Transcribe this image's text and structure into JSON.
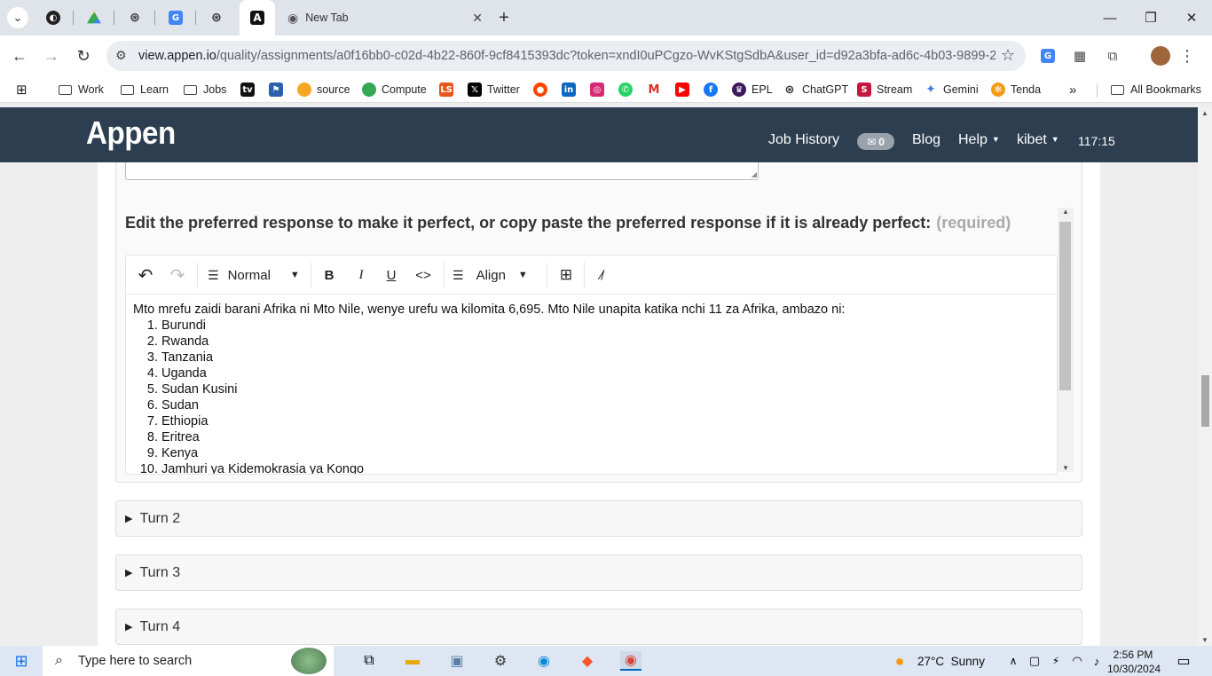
{
  "browser": {
    "tab_title": "New Tab",
    "url_host": "view.appen.io",
    "url_path": "/quality/assignments/a0f16bb0-c02d-4b22-860f-9cf8415393dc?token=xndI0uPCgzo-WvKStgSdbA&user_id=d92a3bfa-ad6c-4b03-9899-2d...",
    "bookmarks": [
      {
        "label": "Work",
        "icon": "folder-icon"
      },
      {
        "label": "Learn",
        "icon": "folder-icon"
      },
      {
        "label": "Jobs",
        "icon": "folder-icon"
      },
      {
        "label": "source",
        "icon": "source-icon"
      },
      {
        "label": "Compute",
        "icon": "compute-icon"
      },
      {
        "label": "Twitter",
        "icon": "x-icon"
      },
      {
        "label": "EPL",
        "icon": "epl-icon"
      },
      {
        "label": "ChatGPT",
        "icon": "chatgpt-icon"
      },
      {
        "label": "Stream",
        "icon": "stream-icon"
      },
      {
        "label": "Gemini",
        "icon": "gemini-icon"
      },
      {
        "label": "Tenda",
        "icon": "tenda-icon"
      }
    ],
    "all_bookmarks": "All Bookmarks"
  },
  "app": {
    "logo": "Appen",
    "nav": {
      "job_history": "Job History",
      "message_count": "0",
      "blog": "Blog",
      "help": "Help",
      "user": "kibet",
      "timer": "117:15"
    }
  },
  "form": {
    "question_label": "Edit the preferred response to make it perfect, or copy paste the preferred response if it is already perfect:",
    "required_label": "(required)",
    "toolbar": {
      "format_select": "Normal",
      "align_select": "Align"
    },
    "editor_intro": "Mto mrefu zaidi barani Afrika ni Mto Nile, wenye urefu wa kilomita 6,695. Mto Nile unapita katika nchi 11 za Afrika, ambazo ni:",
    "countries": [
      {
        "n": "1.",
        "name": "Burundi"
      },
      {
        "n": "2.",
        "name": "Rwanda"
      },
      {
        "n": "3.",
        "name": "Tanzania"
      },
      {
        "n": "4.",
        "name": "Uganda"
      },
      {
        "n": "5.",
        "name": "Sudan Kusini"
      },
      {
        "n": "6.",
        "name": "Sudan"
      },
      {
        "n": "7.",
        "name": "Ethiopia"
      },
      {
        "n": "8.",
        "name": "Eritrea"
      },
      {
        "n": "9.",
        "name": "Kenya"
      },
      {
        "n": "10.",
        "name": "Jamhuri ya Kidemokrasia ya Kongo"
      }
    ],
    "turns": [
      "Turn 2",
      "Turn 3",
      "Turn 4"
    ]
  },
  "taskbar": {
    "search_placeholder": "Type here to search",
    "weather": "27°C  Sunny",
    "time": "2:56 PM",
    "date": "10/30/2024"
  }
}
